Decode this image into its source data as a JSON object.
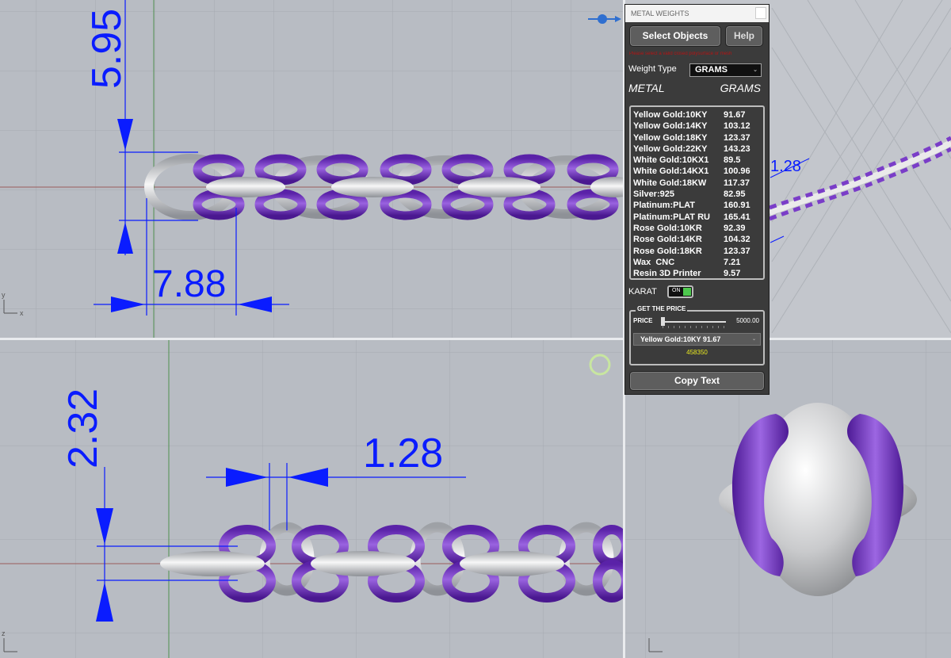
{
  "viewports": {
    "top_left": {
      "dim_vertical": "5.95",
      "dim_horizontal": "7.88",
      "dim_partial": "1.28"
    },
    "bottom_left": {
      "dim_vertical": "2.32",
      "dim_horizontal": "1.28"
    },
    "axis_x": "x",
    "axis_y": "y",
    "axis_z": "z"
  },
  "panel": {
    "title": "METAL WEIGHTS",
    "select_objects_label": "Select Objects",
    "help_label": "Help",
    "warning_text": "Please select a valid closed polysurface or mesh",
    "weight_type_label": "Weight Type",
    "weight_type_value": "GRAMS",
    "col_metal": "METAL",
    "col_units": "GRAMS",
    "weights": [
      {
        "metal": "Yellow Gold:10KY",
        "value": "91.67"
      },
      {
        "metal": "Yellow Gold:14KY",
        "value": "103.12"
      },
      {
        "metal": "Yellow Gold:18KY",
        "value": "123.37"
      },
      {
        "metal": "Yellow Gold:22KY",
        "value": "143.23"
      },
      {
        "metal": "White Gold:10KX1",
        "value": "89.5"
      },
      {
        "metal": "White Gold:14KX1",
        "value": "100.96"
      },
      {
        "metal": "White Gold:18KW",
        "value": "117.37"
      },
      {
        "metal": "Silver:925",
        "value": "82.95"
      },
      {
        "metal": "Platinum:PLAT",
        "value": "160.91"
      },
      {
        "metal": "Platinum:PLAT RU",
        "value": "165.41"
      },
      {
        "metal": "Rose Gold:10KR",
        "value": "92.39"
      },
      {
        "metal": "Rose Gold:14KR",
        "value": "104.32"
      },
      {
        "metal": "Rose Gold:18KR",
        "value": "123.37"
      },
      {
        "metal": "Wax  CNC",
        "value": "7.21"
      },
      {
        "metal": "Resin 3D Printer",
        "value": "9.57"
      }
    ],
    "karat_label": "KARAT",
    "karat_toggle": "ON",
    "price_group_title": "GET THE PRICE",
    "price_label": "PRICE",
    "price_value": "5000.00",
    "price_slider_fraction": 0.0,
    "price_metal_select": "Yellow Gold:10KY 91.67",
    "price_result": "458350",
    "copy_text_label": "Copy Text"
  },
  "colors": {
    "dimension": "#0a1cff",
    "purple_link": "#7a3dc8",
    "silver_link": "#e6e6e6",
    "viewport_bg": "#b8bcc3",
    "panel_bg": "#3b3b3b",
    "price_result": "#e8e821"
  }
}
